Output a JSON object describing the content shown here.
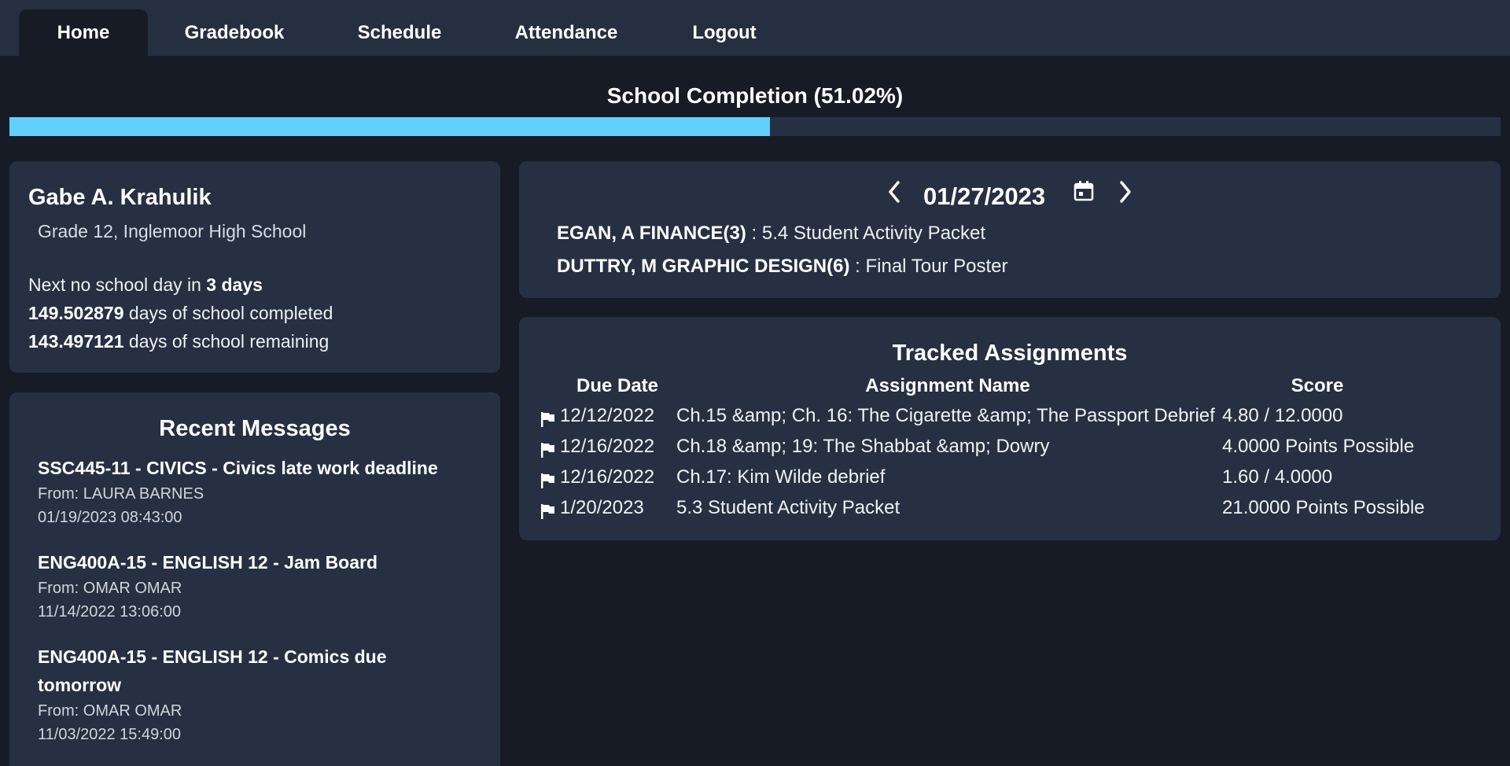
{
  "nav": {
    "tabs": [
      {
        "label": "Home",
        "active": true
      },
      {
        "label": "Gradebook",
        "active": false
      },
      {
        "label": "Schedule",
        "active": false
      },
      {
        "label": "Attendance",
        "active": false
      },
      {
        "label": "Logout",
        "active": false
      }
    ]
  },
  "completion": {
    "title": "School Completion (51.02%)",
    "percent": 51.02,
    "fill_color": "#63d0fb"
  },
  "profile": {
    "name": "Gabe A. Krahulik",
    "grade_school": "Grade 12, Inglemoor High School",
    "next_no_school_prefix": "Next no school day in ",
    "next_no_school_value": "3 days",
    "completed_value": "149.502879",
    "completed_suffix": " days of school completed",
    "remaining_value": "143.497121",
    "remaining_suffix": " days of school remaining"
  },
  "messages": {
    "heading": "Recent Messages",
    "items": [
      {
        "title": "SSC445-11 - CIVICS - Civics late work deadline",
        "from": "From: LAURA BARNES",
        "date": "01/19/2023 08:43:00"
      },
      {
        "title": "ENG400A-15 - ENGLISH 12 - Jam Board",
        "from": "From: OMAR OMAR",
        "date": "11/14/2022 13:06:00"
      },
      {
        "title": "ENG400A-15 - ENGLISH 12 - Comics due tomorrow",
        "from": "From: OMAR OMAR",
        "date": "11/03/2022 15:49:00"
      }
    ]
  },
  "day_view": {
    "date": "01/27/2023",
    "icons": {
      "prev": "chevron-left-icon",
      "calendar": "calendar-icon",
      "next": "chevron-right-icon"
    },
    "items": [
      {
        "class": "EGAN, A FINANCE(3)",
        "assignment": " : 5.4 Student Activity Packet"
      },
      {
        "class": "DUTTRY, M GRAPHIC DESIGN(6)",
        "assignment": " : Final Tour Poster"
      }
    ]
  },
  "tracked": {
    "heading": "Tracked Assignments",
    "columns": [
      "Due Date",
      "Assignment Name",
      "Score"
    ],
    "rows": [
      {
        "due": "12/12/2022",
        "name": "Ch.15 &amp; Ch. 16: The Cigarette &amp; The Passport Debrief",
        "score": "4.80 / 12.0000"
      },
      {
        "due": "12/16/2022",
        "name": "Ch.18 &amp; 19: The Shabbat &amp; Dowry",
        "score": "4.0000 Points Possible"
      },
      {
        "due": "12/16/2022",
        "name": "Ch.17: Kim Wilde debrief",
        "score": "1.60 / 4.0000"
      },
      {
        "due": "1/20/2023",
        "name": "5.3 Student Activity Packet",
        "score": "21.0000 Points Possible"
      }
    ],
    "row_icon": "flag-icon"
  }
}
